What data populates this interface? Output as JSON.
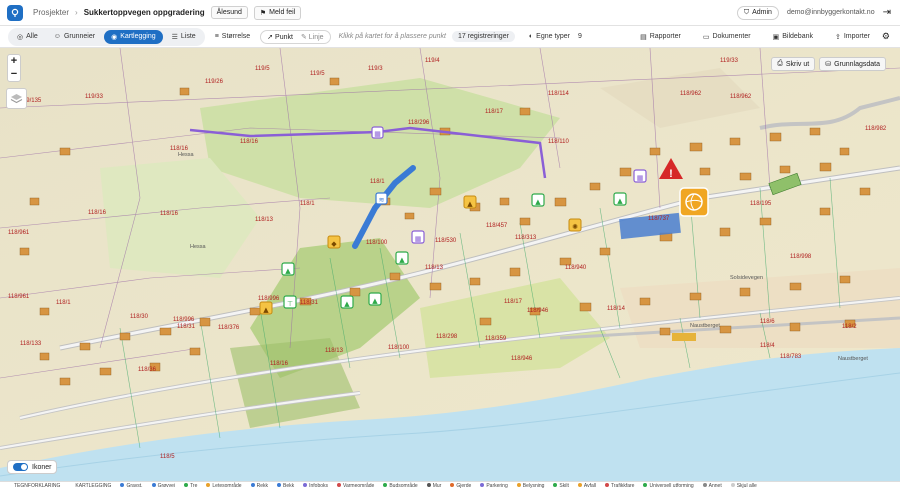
{
  "header": {
    "breadcrumb_root": "Prosjekter",
    "project_name": "Sukkertoppvegen oppgradering",
    "location_tag": "Ålesund",
    "report_error_label": "Meld feil",
    "admin_label": "Admin",
    "user_email": "demo@innbyggerkontakt.no"
  },
  "toolbar": {
    "tabs": [
      {
        "label": "Alle"
      },
      {
        "label": "Grunneier"
      },
      {
        "label": "Kartlegging"
      },
      {
        "label": "Liste"
      }
    ],
    "size_label": "Størrelse",
    "point_label": "Punkt",
    "line_label": "Linje",
    "hint": "Klikk på kartet for å plassere punkt",
    "registrations": "17 registreringer",
    "own_types_label": "Egne typer",
    "own_types_count": "9",
    "reports_label": "Rapporter",
    "documents_label": "Dokumenter",
    "image_bank_label": "Bildebank",
    "import_label": "Importer"
  },
  "map": {
    "print_label": "Skriv ut",
    "base_data_label": "Grunnlagsdata",
    "icons_toggle_label": "Ikoner",
    "place_names": {
      "hessa": "Hessa",
      "hessa2": "Hessa",
      "naustberget": "Naustberget",
      "solsidevegen": "Solsidevegen",
      "naustberget_road": "Naustberget"
    },
    "parcels": [
      "119/135",
      "119/33",
      "119/26",
      "119/5",
      "119/5",
      "119/3",
      "119/4",
      "119/33",
      "118/16",
      "118/16",
      "118/296",
      "118/17",
      "118/114",
      "118/110",
      "118/962",
      "118/962",
      "118/982",
      "118/16",
      "118/1",
      "118/16",
      "118/13",
      "118/1",
      "118/13",
      "118/100",
      "118/530",
      "118/457",
      "118/313",
      "118/195",
      "118/737",
      "118/998",
      "118/961",
      "118/961",
      "118/1",
      "118/996",
      "118/31",
      "118/31",
      "118/30",
      "118/996",
      "118/376",
      "118/13",
      "118/100",
      "118/298",
      "118/359",
      "118/946",
      "118/940",
      "118/14",
      "118/17",
      "118/946",
      "118/783",
      "118/133",
      "118/16",
      "118/36",
      "118/2",
      "118/4",
      "118/5",
      "118/6"
    ]
  },
  "legend": {
    "items": [
      {
        "label": "TEGNFORKLARING",
        "color": "#ffffff"
      },
      {
        "label": "KARTLEGGING",
        "color": "#ffffff"
      },
      {
        "label": "Gravst.",
        "color": "#3a7bd5"
      },
      {
        "label": "Grøvvei",
        "color": "#3a7bd5"
      },
      {
        "label": "Tre",
        "color": "#2eaa4a"
      },
      {
        "label": "Letesområde",
        "color": "#e9a12a"
      },
      {
        "label": "Rekk",
        "color": "#3a7bd5"
      },
      {
        "label": "Bekk",
        "color": "#3a7bd5"
      },
      {
        "label": "Infoboks",
        "color": "#7b6bd6"
      },
      {
        "label": "Varmeområde",
        "color": "#d24a4a"
      },
      {
        "label": "Budsområde",
        "color": "#2eaa4a"
      },
      {
        "label": "Mur",
        "color": "#555555"
      },
      {
        "label": "Gjerde",
        "color": "#e06a2a"
      },
      {
        "label": "Parkering",
        "color": "#7b6bd6"
      },
      {
        "label": "Belysning",
        "color": "#e9a12a"
      },
      {
        "label": "Skilt",
        "color": "#2eaa4a"
      },
      {
        "label": "Avfall",
        "color": "#e9a12a"
      },
      {
        "label": "Trafikkfare",
        "color": "#d24a4a"
      },
      {
        "label": "Universell utforming",
        "color": "#2eaa4a"
      },
      {
        "label": "Annet",
        "color": "#888888"
      },
      {
        "label": "Skjul alle",
        "color": "#cccccc"
      }
    ]
  },
  "colors": {
    "accent": "#1f6fc4",
    "purple_line": "#8a5fd6",
    "blue_line": "#3a7bd5",
    "warning": "#d62828",
    "sea": "#bfe1f0"
  }
}
